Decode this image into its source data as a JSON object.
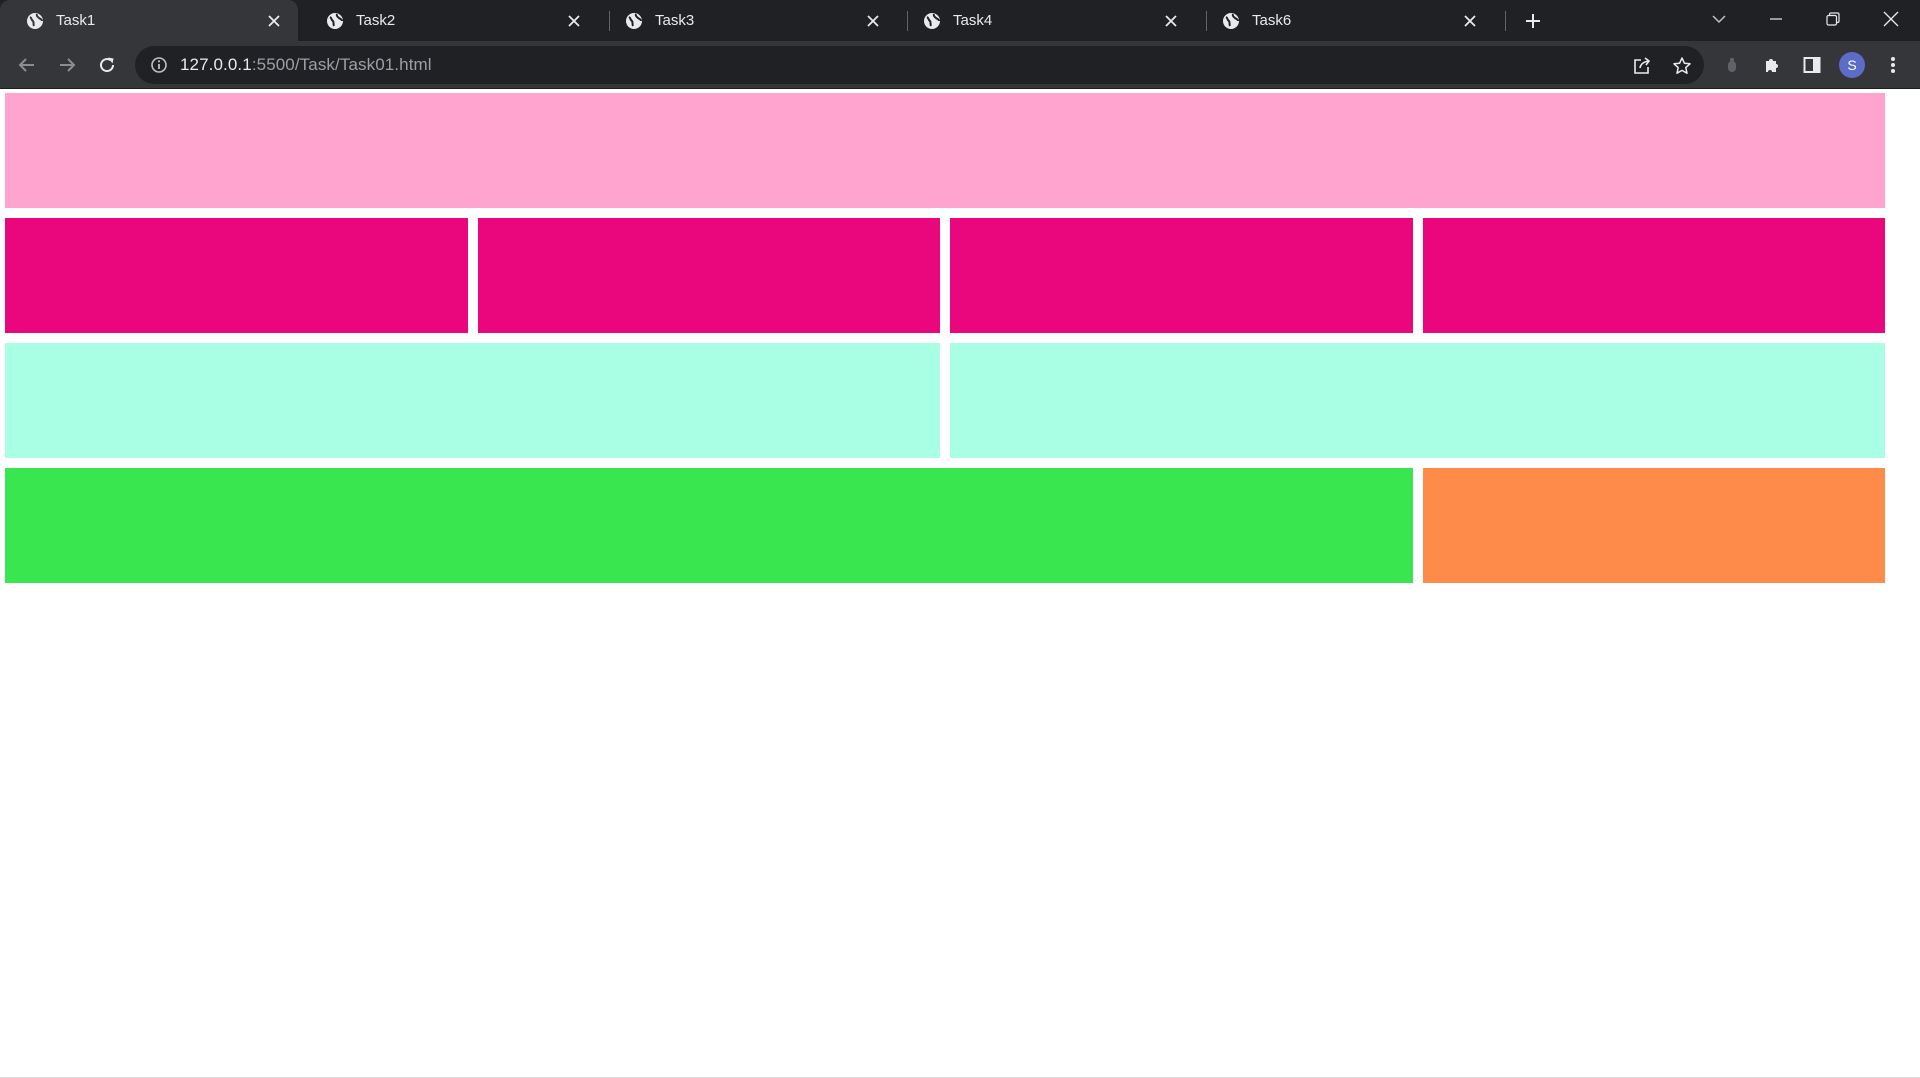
{
  "browser": {
    "tabs": [
      {
        "title": "Task1",
        "active": true
      },
      {
        "title": "Task2",
        "active": false
      },
      {
        "title": "Task3",
        "active": false
      },
      {
        "title": "Task4",
        "active": false
      },
      {
        "title": "Task6",
        "active": false
      }
    ],
    "new_tab_icon": "plus-icon",
    "window_controls": [
      "tab-search-icon",
      "minimize-icon",
      "restore-icon",
      "close-icon"
    ],
    "url": {
      "host": "127.0.0.1",
      "rest": ":5500/Task/Task01.html"
    },
    "profile_initial": "S",
    "toolbar_icons": [
      "share-icon",
      "bookmark-star-icon",
      "extension-icon",
      "puzzle-icon",
      "side-panel-icon",
      "more-menu-icon"
    ]
  },
  "page": {
    "colors": {
      "light_pink": "#ffa3cf",
      "magenta": "#ea067d",
      "mint": "#a9ffe3",
      "green": "#3ae650",
      "orange": "#ff8b4b"
    },
    "rows": [
      {
        "blocks": [
          "light_pink"
        ]
      },
      {
        "blocks": [
          "magenta",
          "magenta",
          "magenta",
          "magenta"
        ]
      },
      {
        "blocks": [
          "mint",
          "mint"
        ]
      },
      {
        "blocks": [
          "green",
          "orange"
        ]
      }
    ]
  }
}
